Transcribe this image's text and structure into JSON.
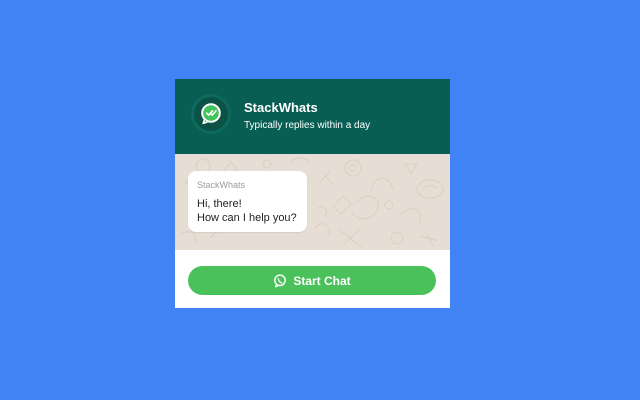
{
  "widget": {
    "brand_name": "StackWhats",
    "brand_status": "Typically replies within a day",
    "avatar_icon": "whatsapp-logo-icon",
    "header_color": "#095e54"
  },
  "chat": {
    "sender": "StackWhats",
    "message_line_1": "Hi, there!",
    "message_line_2": "How can I help you?"
  },
  "footer": {
    "button_label": "Start Chat",
    "button_icon": "whatsapp-icon",
    "button_color": "#4ac15a"
  },
  "page": {
    "background_color": "#4183f5"
  }
}
